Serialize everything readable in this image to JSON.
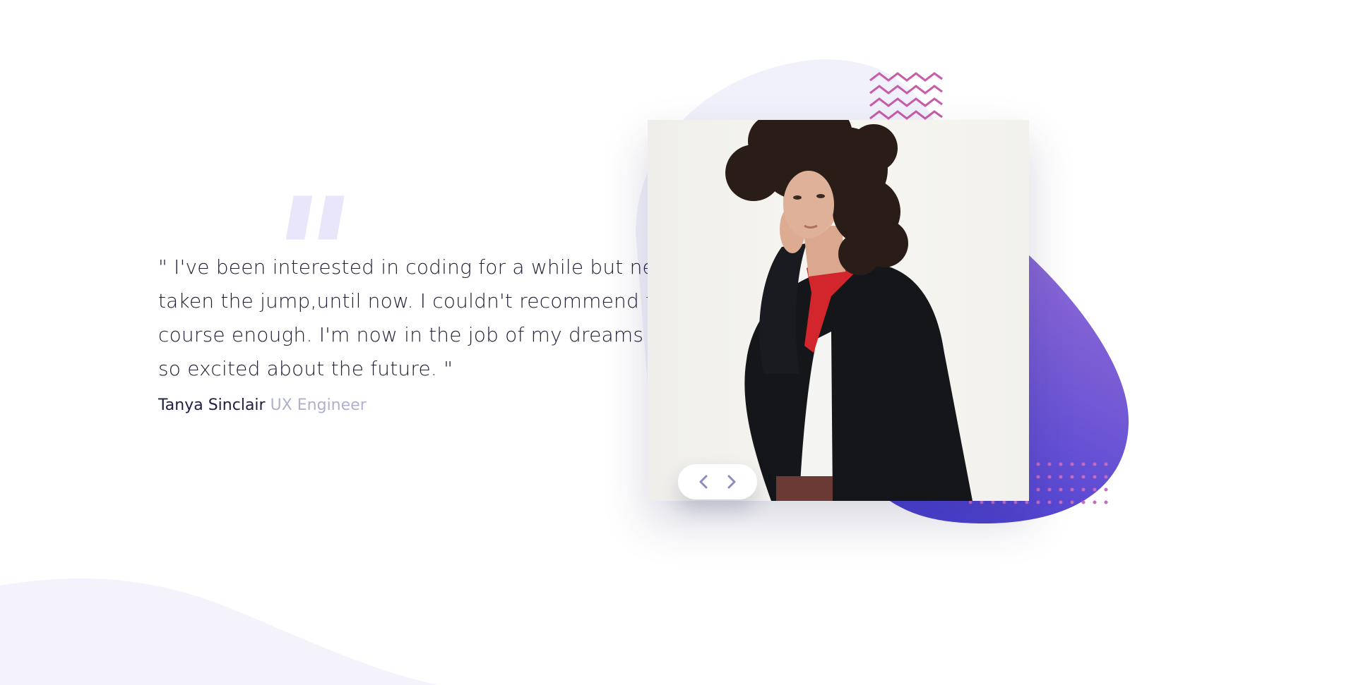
{
  "testimonial": {
    "quote": "\" I've been interested in coding for a while but never taken the jump,until now. I couldn't recommend this course enough. I'm now in the job of my dreams and so excited about the future. \"",
    "author_name": "Tanya Sinclair",
    "author_role": "UX Engineer"
  },
  "colors": {
    "text_dark": "#202038",
    "role_muted": "#aeb0cc",
    "accent_blob_start": "#8b6ad6",
    "accent_blob_end": "#4b3fd2",
    "pattern_pink": "#c45aa5",
    "quote_mark": "#e9e6fb"
  },
  "icons": {
    "prev": "chevron-left-icon",
    "next": "chevron-right-icon"
  }
}
